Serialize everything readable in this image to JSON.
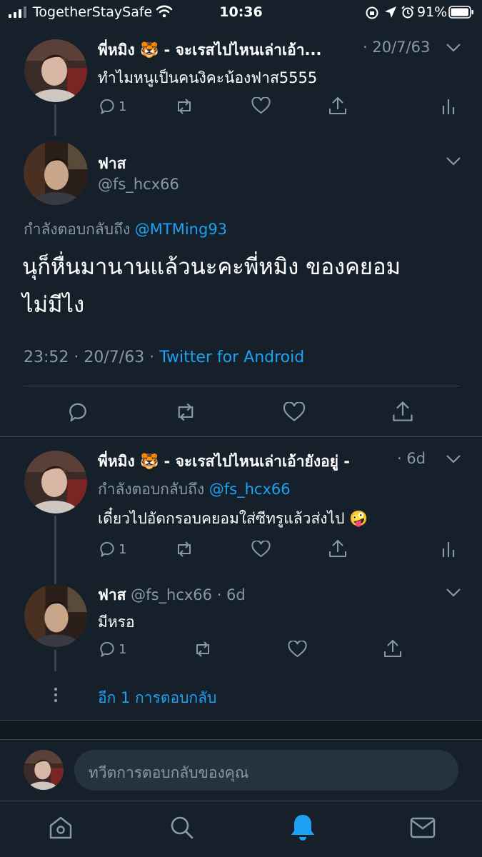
{
  "status_bar": {
    "carrier": "TogetherStaySafe",
    "time": "10:36",
    "battery": "91%"
  },
  "tweet1": {
    "name": "พี่หมิง 🐯 - จะเรสไปไหนเล่าเอ้า...",
    "date": "· 20/7/63",
    "text": "ทำไมหนูเป็นคนงิคะน้องฟาส5555",
    "reply_count": "1"
  },
  "main_tweet": {
    "name": "ฟาส",
    "handle": "@fs_hcx66",
    "replying_to_label": "กำลังตอบกลับถึง",
    "replying_to_handle": "@MTMing93",
    "text_line1": "นุก็หื่นมานานแล้วนะคะพี่หมิง ของคยอม",
    "text_line2": "ไม่มีไง",
    "timestamp": "23:52 · 20/7/63 ·",
    "source": "Twitter for Android"
  },
  "reply1": {
    "name": "พี่หมิง 🐯 - จะเรสไปไหนเล่าเอ้ายังอยู่ -",
    "date": "· 6d",
    "replying_to_label": "กำลังตอบกลับถึง",
    "replying_to_handle": "@fs_hcx66",
    "text": "เดี๋ยวไปอัดกรอบคยอมใส่ซีทรูแล้วส่งไป 🤪",
    "reply_count": "1"
  },
  "reply2": {
    "name": "ฟาส",
    "handle": "@fs_hcx66",
    "date": "· 6d",
    "text": "มีหรอ",
    "reply_count": "1"
  },
  "more_replies": "อีก 1 การตอบกลับ",
  "compose": {
    "placeholder": "ทวีตการตอบกลับของคุณ"
  },
  "colors": {
    "background": "#15202b",
    "accent": "#1da1f2",
    "muted": "#8899a6",
    "divider": "#38444d"
  }
}
